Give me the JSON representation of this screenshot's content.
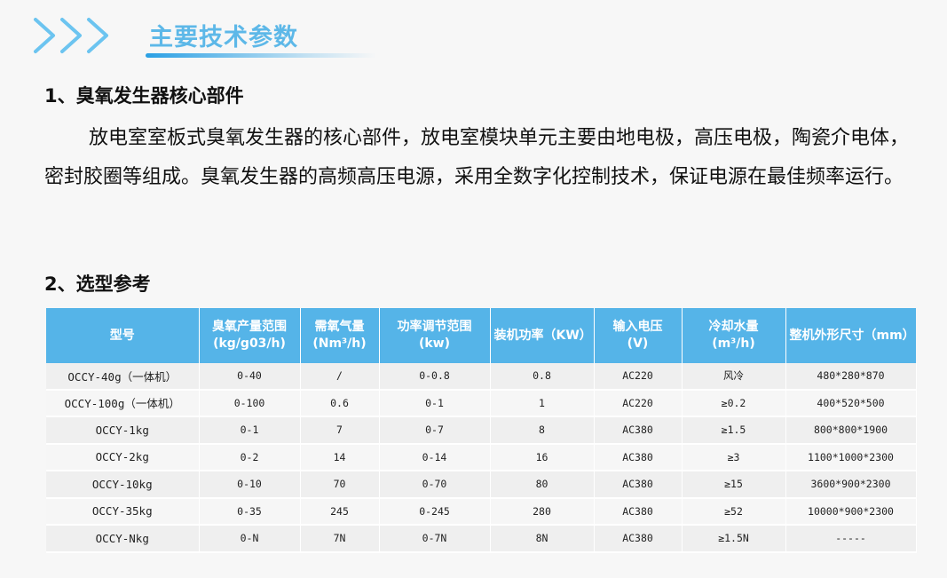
{
  "header": {
    "title": "主要技术参数"
  },
  "section1": {
    "heading": "1、臭氧发生器核心部件",
    "paragraph": "放电室室板式臭氧发生器的核心部件，放电室模块单元主要由地电极，高压电极，陶瓷介电体，密封胶圈等组成。臭氧发生器的高频高压电源，采用全数字化控制技术，保证电源在最佳频率运行。"
  },
  "section2": {
    "heading": "2、选型参考"
  },
  "table": {
    "headers": [
      [
        "型号"
      ],
      [
        "臭氧产量范围",
        "(kg/g03/h)"
      ],
      [
        "需氧气量",
        "(Nm³/h)"
      ],
      [
        "功率调节范围",
        "(kw)"
      ],
      [
        "装机功率（KW）"
      ],
      [
        "输入电压",
        "(V)"
      ],
      [
        "冷却水量",
        "(m³/h)"
      ],
      [
        "整机外形尺寸（mm）"
      ]
    ],
    "rows": [
      [
        "OCCY-40g（一体机）",
        "0-40",
        "/",
        "0-0.8",
        "0.8",
        "AC220",
        "风冷",
        "480*280*870"
      ],
      [
        "OCCY-100g（一体机）",
        "0-100",
        "0.6",
        "0-1",
        "1",
        "AC220",
        "≥0.2",
        "400*520*500"
      ],
      [
        "OCCY-1kg",
        "0-1",
        "7",
        "0-7",
        "8",
        "AC380",
        "≥1.5",
        "800*800*1900"
      ],
      [
        "OCCY-2kg",
        "0-2",
        "14",
        "0-14",
        "16",
        "AC380",
        "≥3",
        "1100*1000*2300"
      ],
      [
        "OCCY-10kg",
        "0-10",
        "70",
        "0-70",
        "80",
        "AC380",
        "≥15",
        "3600*900*2300"
      ],
      [
        "OCCY-35kg",
        "0-35",
        "245",
        "0-245",
        "280",
        "AC380",
        "≥52",
        "10000*900*2300"
      ],
      [
        "OCCY-Nkg",
        "0-N",
        "7N",
        "0-7N",
        "8N",
        "AC380",
        "≥1.5N",
        "-----"
      ]
    ]
  },
  "colors": {
    "accent": "#5db8e8",
    "header_bg": "#55b4e8",
    "chevron": "#6cc4f0"
  }
}
